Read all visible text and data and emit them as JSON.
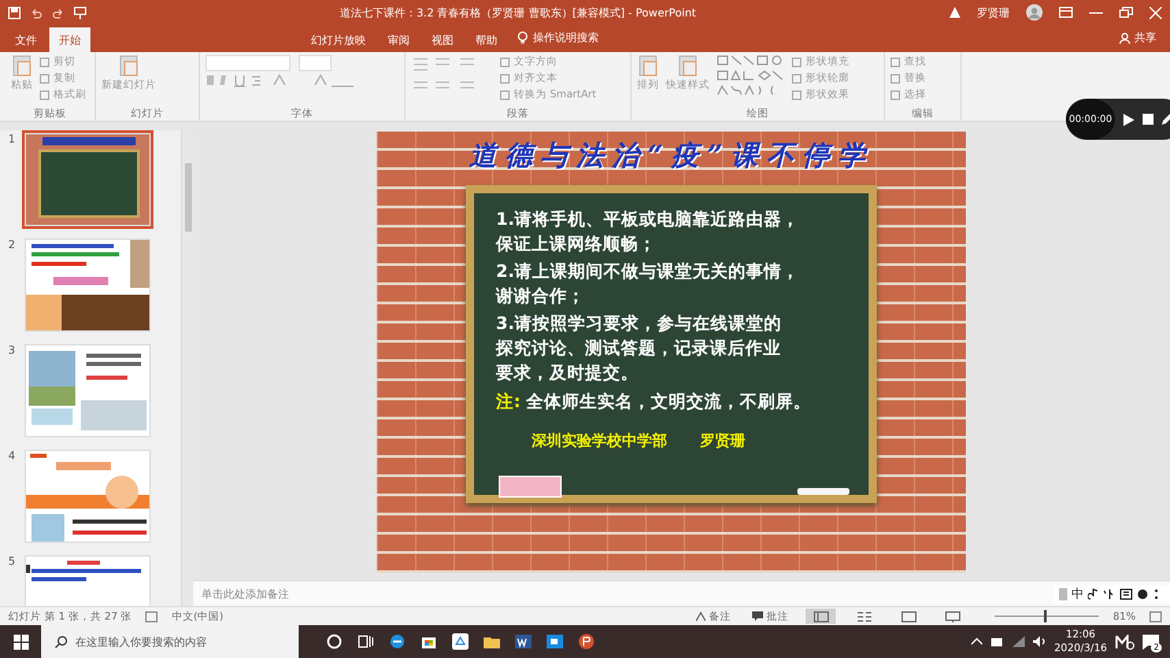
{
  "window": {
    "title": "道法七下课件：3.2 青春有格（罗贤珊 曹歌东）[兼容模式] - PowerPoint",
    "user": "罗贤珊",
    "share": "共享"
  },
  "tabs": [
    {
      "label": "文件",
      "selected": false
    },
    {
      "label": "开始",
      "selected": true
    },
    {
      "label": "幻灯片放映",
      "selected": false
    },
    {
      "label": "审阅",
      "selected": false
    },
    {
      "label": "视图",
      "selected": false
    },
    {
      "label": "帮助",
      "selected": false
    }
  ],
  "tell_me": "操作说明搜索",
  "ribbon_groups": [
    {
      "label": "剪贴板",
      "large": [
        "粘贴"
      ],
      "items": [
        "剪切",
        "复制",
        "格式刷"
      ]
    },
    {
      "label": "幻灯片",
      "large": [
        "新建幻灯片"
      ]
    },
    {
      "label": "字体"
    },
    {
      "label": "段落",
      "items": [
        "文字方向",
        "对齐文本",
        "转换为 SmartArt"
      ]
    },
    {
      "label": "绘图",
      "large": [
        "排列",
        "快速样式"
      ],
      "items": [
        "形状填充",
        "形状轮廓",
        "形状效果"
      ]
    },
    {
      "label": "编辑",
      "items": [
        "查找",
        "替换",
        "选择"
      ]
    }
  ],
  "recorder": {
    "time": "00:00:00"
  },
  "thumbnails": [
    {
      "number": "1",
      "selected": true,
      "kind": "chalkboard"
    },
    {
      "number": "2",
      "selected": false,
      "kind": "collage"
    },
    {
      "number": "3",
      "selected": false,
      "kind": "photos"
    },
    {
      "number": "4",
      "selected": false,
      "kind": "poster"
    },
    {
      "number": "5",
      "selected": false,
      "kind": "text"
    }
  ],
  "slide": {
    "title": "道德与法治“疫”课不停学",
    "items": [
      [
        "1.请将手机、平板或电脑靠近路由器，",
        "保证上课网络顺畅；"
      ],
      [
        "2.请上课期间不做与课堂无关的事情，",
        "谢谢合作；"
      ],
      [
        "3.请按照学习要求，参与在线课堂的",
        "探究讨论、测试答题，记录课后作业",
        "要求，及时提交。"
      ]
    ],
    "note_label": "注:",
    "note": "全体师生实名，文明交流，不刷屏。",
    "footer": [
      "深圳实验学校中学部",
      "罗贤珊"
    ]
  },
  "notes_placeholder": "单击此处添加备注",
  "ime": "中",
  "status": {
    "slide": "幻灯片 第 1 张，共 27 张",
    "language": "中文(中国)",
    "notes": "备注",
    "comments": "批注",
    "zoom": "81%",
    "zoom_slider": {
      "level": 0.47
    }
  },
  "taskbar": {
    "search_placeholder": "在这里输入你要搜索的内容",
    "time": "12:06",
    "date": "2020/3/16",
    "notifications": "2"
  }
}
